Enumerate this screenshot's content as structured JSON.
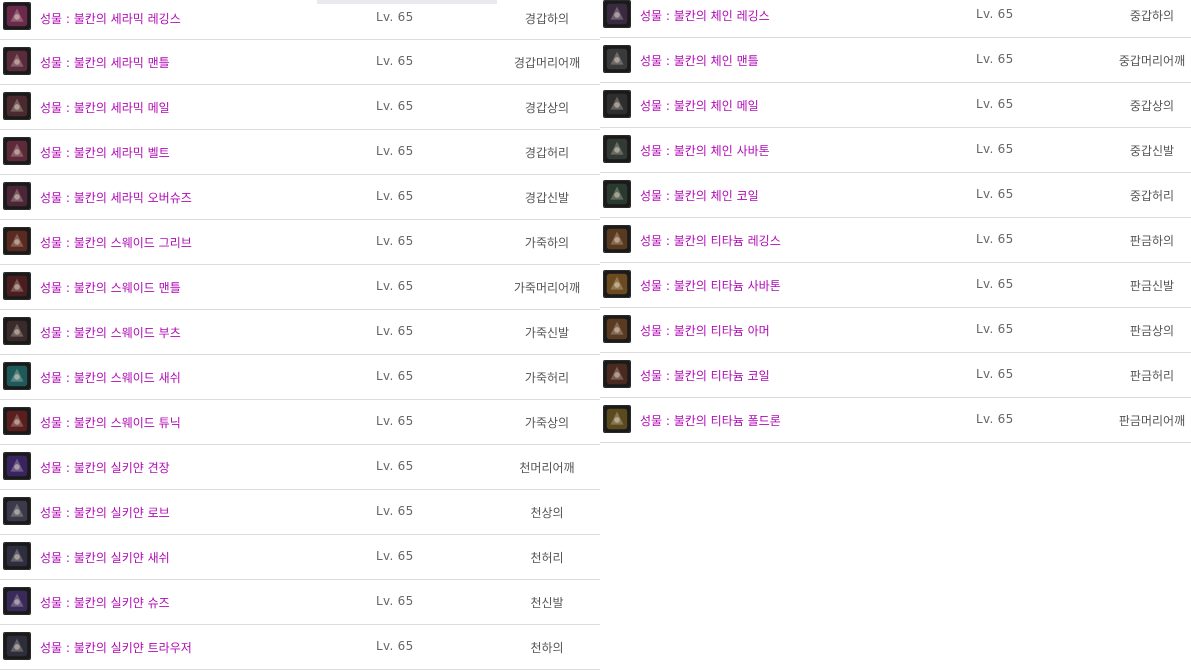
{
  "left": [
    {
      "name": "성물 : 불칸의 세라믹 레깅스",
      "level": "Lv. 65",
      "type": "경갑하의",
      "icon": "leggings-icon",
      "color": "#6b2a4a"
    },
    {
      "name": "성물 : 불칸의 세라믹 맨틀",
      "level": "Lv. 65",
      "type": "경갑머리어깨",
      "icon": "mantle-icon",
      "color": "#5a2b3a"
    },
    {
      "name": "성물 : 불칸의 세라믹 메일",
      "level": "Lv. 65",
      "type": "경갑상의",
      "icon": "mail-icon",
      "color": "#4a2a2e"
    },
    {
      "name": "성물 : 불칸의 세라믹 벨트",
      "level": "Lv. 65",
      "type": "경갑허리",
      "icon": "belt-icon",
      "color": "#5e2a3a"
    },
    {
      "name": "성물 : 불칸의 세라믹 오버슈즈",
      "level": "Lv. 65",
      "type": "경갑신발",
      "icon": "shoes-icon",
      "color": "#4c2636"
    },
    {
      "name": "성물 : 불칸의 스웨이드 그리브",
      "level": "Lv. 65",
      "type": "가죽하의",
      "icon": "greaves-icon",
      "color": "#5a2a20"
    },
    {
      "name": "성물 : 불칸의 스웨이드 맨틀",
      "level": "Lv. 65",
      "type": "가죽머리어깨",
      "icon": "mantle-icon",
      "color": "#4a1e1e"
    },
    {
      "name": "성물 : 불칸의 스웨이드 부츠",
      "level": "Lv. 65",
      "type": "가죽신발",
      "icon": "boots-icon",
      "color": "#3a2a2a"
    },
    {
      "name": "성물 : 불칸의 스웨이드 새쉬",
      "level": "Lv. 65",
      "type": "가죽허리",
      "icon": "sash-icon",
      "color": "#1f5a5a"
    },
    {
      "name": "성물 : 불칸의 스웨이드 튜닉",
      "level": "Lv. 65",
      "type": "가죽상의",
      "icon": "tunic-icon",
      "color": "#5a1e1e"
    },
    {
      "name": "성물 : 불칸의 실키얀 견장",
      "level": "Lv. 65",
      "type": "천머리어깨",
      "icon": "epaulette-icon",
      "color": "#3a2460"
    },
    {
      "name": "성물 : 불칸의 실키얀 로브",
      "level": "Lv. 65",
      "type": "천상의",
      "icon": "robe-icon",
      "color": "#3a3a4a"
    },
    {
      "name": "성물 : 불칸의 실키얀 새쉬",
      "level": "Lv. 65",
      "type": "천허리",
      "icon": "sash-icon",
      "color": "#2e2e3e"
    },
    {
      "name": "성물 : 불칸의 실키얀 슈즈",
      "level": "Lv. 65",
      "type": "천신발",
      "icon": "shoes-icon",
      "color": "#3a2a5a"
    },
    {
      "name": "성물 : 불칸의 실키얀 트라우저",
      "level": "Lv. 65",
      "type": "천하의",
      "icon": "trousers-icon",
      "color": "#2e2e3a"
    }
  ],
  "right": [
    {
      "name": "성물 : 불칸의 체인 레깅스",
      "level": "Lv. 65",
      "type": "중갑하의",
      "icon": "leggings-icon",
      "color": "#3a2a40"
    },
    {
      "name": "성물 : 불칸의 체인 맨틀",
      "level": "Lv. 65",
      "type": "중갑머리어깨",
      "icon": "mantle-icon",
      "color": "#3a3a3a"
    },
    {
      "name": "성물 : 불칸의 체인 메일",
      "level": "Lv. 65",
      "type": "중갑상의",
      "icon": "mail-icon",
      "color": "#2e2e2e"
    },
    {
      "name": "성물 : 불칸의 체인 사바톤",
      "level": "Lv. 65",
      "type": "중갑신발",
      "icon": "sabaton-icon",
      "color": "#333a33"
    },
    {
      "name": "성물 : 불칸의 체인 코일",
      "level": "Lv. 65",
      "type": "중갑허리",
      "icon": "coil-icon",
      "color": "#2a3a2e"
    },
    {
      "name": "성물 : 불칸의 티타늄 레깅스",
      "level": "Lv. 65",
      "type": "판금하의",
      "icon": "leggings-icon",
      "color": "#5a3a1e"
    },
    {
      "name": "성물 : 불칸의 티타늄 사바톤",
      "level": "Lv. 65",
      "type": "판금신발",
      "icon": "sabaton-icon",
      "color": "#6a4a1e"
    },
    {
      "name": "성물 : 불칸의 티타늄 아머",
      "level": "Lv. 65",
      "type": "판금상의",
      "icon": "armor-icon",
      "color": "#5a3a20"
    },
    {
      "name": "성물 : 불칸의 티타늄 코일",
      "level": "Lv. 65",
      "type": "판금허리",
      "icon": "coil-icon",
      "color": "#4a2a1e"
    },
    {
      "name": "성물 : 불칸의 티타늄 폴드론",
      "level": "Lv. 65",
      "type": "판금머리어깨",
      "icon": "pauldron-icon",
      "color": "#5a4a1e"
    }
  ]
}
